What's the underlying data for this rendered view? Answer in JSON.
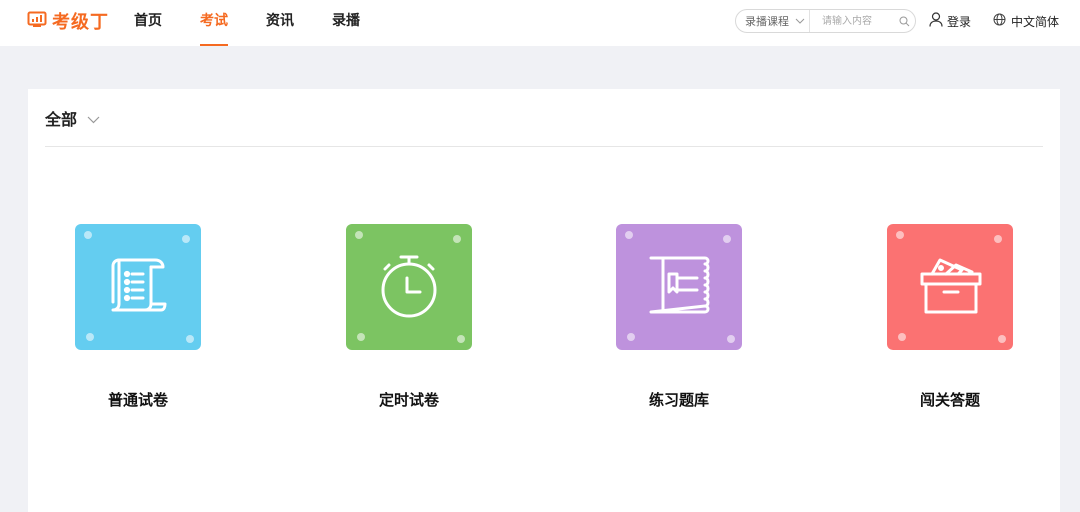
{
  "header": {
    "logo_text": "考级丁",
    "nav": [
      {
        "label": "首页",
        "active": false
      },
      {
        "label": "考试",
        "active": true
      },
      {
        "label": "资讯",
        "active": false
      },
      {
        "label": "录播",
        "active": false
      }
    ],
    "search": {
      "category": "录播课程",
      "placeholder": "请输入内容"
    },
    "login_label": "登录",
    "language_label": "中文简体"
  },
  "filter": {
    "label": "全部"
  },
  "cards": [
    {
      "label": "普通试卷",
      "icon": "scroll-list-icon",
      "color": "#64cdf0"
    },
    {
      "label": "定时试卷",
      "icon": "stopwatch-icon",
      "color": "#7cc462"
    },
    {
      "label": "练习题库",
      "icon": "question-book-icon",
      "color": "#be92dd"
    },
    {
      "label": "闯关答题",
      "icon": "ticket-box-icon",
      "color": "#fb7272"
    }
  ],
  "colors": {
    "accent": "#f56a21",
    "page_background": "#f0f1f5"
  }
}
